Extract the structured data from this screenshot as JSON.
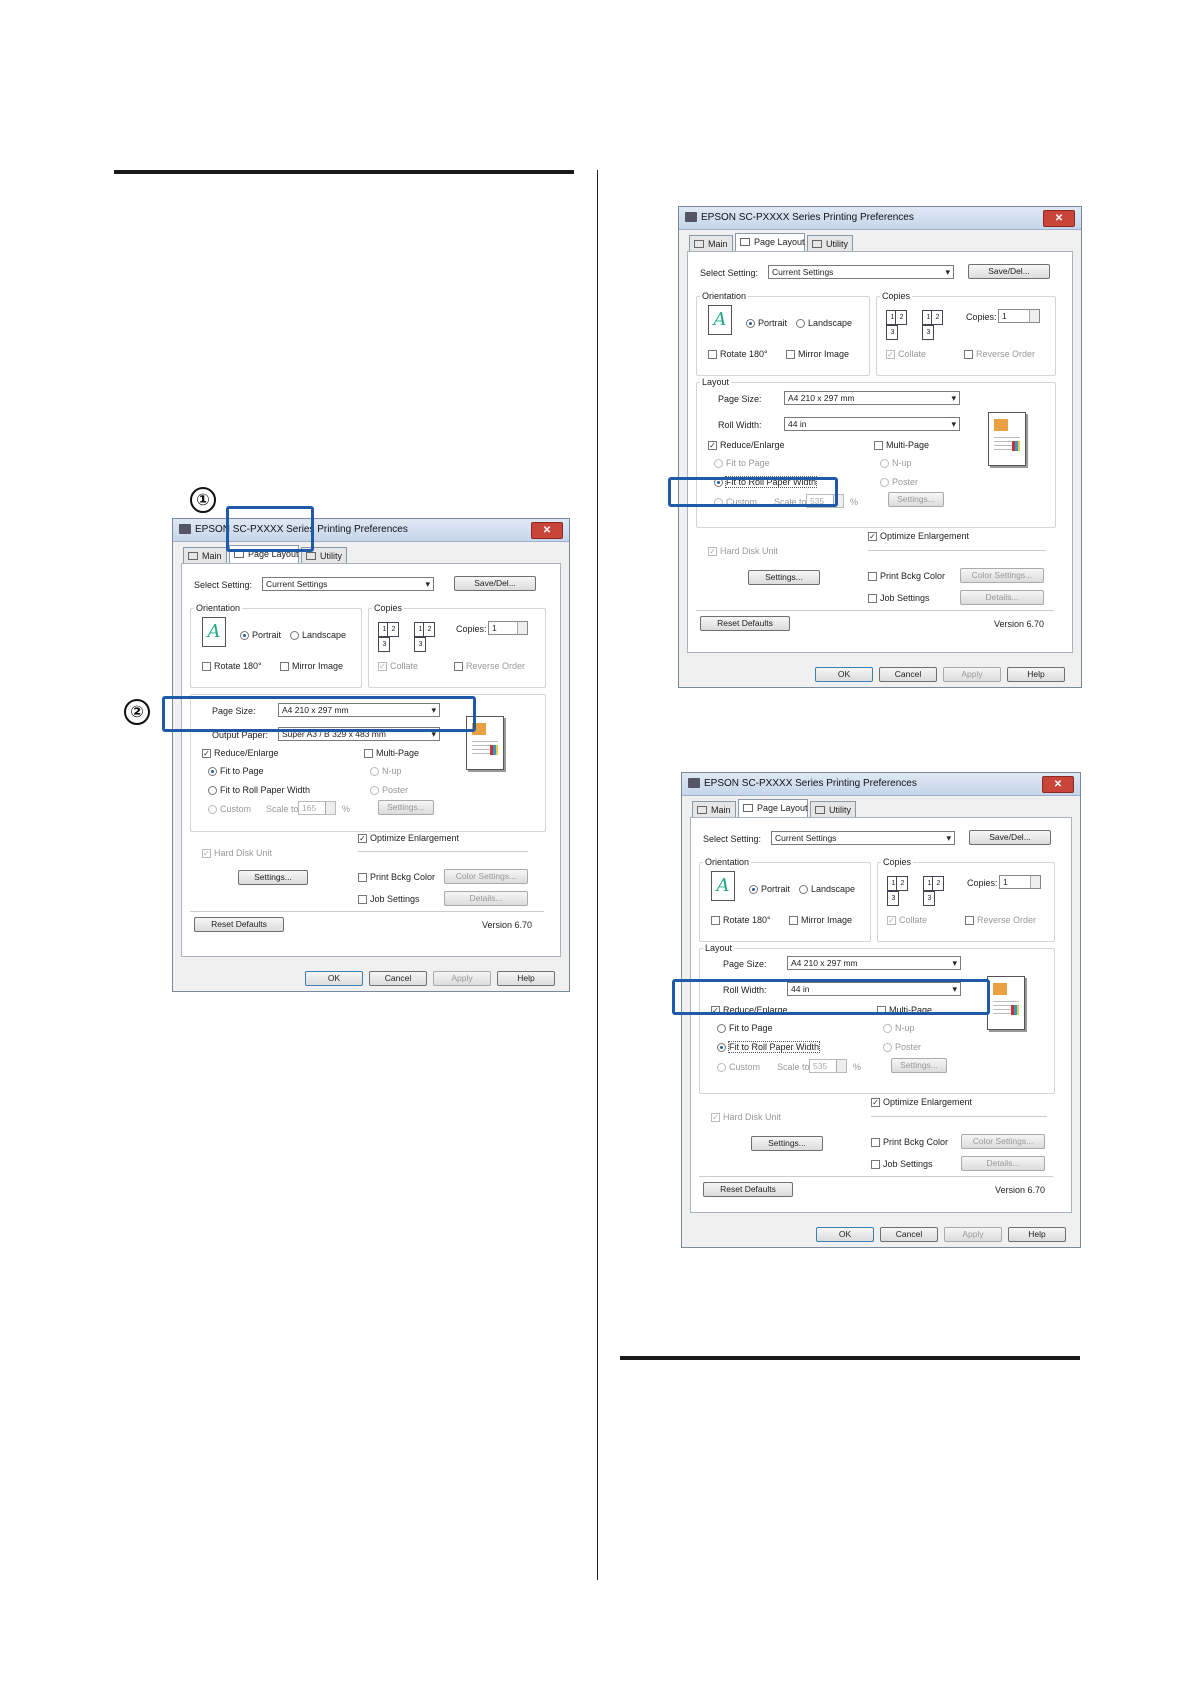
{
  "callouts": {
    "step1": "①",
    "step2": "②"
  },
  "colors": {
    "highlight": "#1e5aa8",
    "rule": "#1a1a1a"
  },
  "dialog1": {
    "title": "EPSON SC-PXXXX Series Printing Preferences",
    "close": "✕",
    "tabs": [
      "Main",
      "Page Layout",
      "Utility"
    ],
    "select_setting_label": "Select Setting:",
    "select_setting_value": "Current Settings",
    "save_del": "Save/Del...",
    "orientation_label": "Orientation",
    "portrait": "Portrait",
    "landscape": "Landscape",
    "rotate": "Rotate 180°",
    "mirror": "Mirror Image",
    "copies_group": "Copies",
    "copies_label": "Copies:",
    "copies_value": "1",
    "collate": "Collate",
    "reverse": "Reverse Order",
    "page_size_label": "Page Size:",
    "page_size_value": "A4 210 x 297 mm",
    "output_paper_label": "Output Paper:",
    "output_paper_value": "Super A3 / B 329 x 483 mm",
    "reduce": "Reduce/Enlarge",
    "fit_page": "Fit to Page",
    "fit_roll": "Fit to Roll Paper Width",
    "custom": "Custom",
    "scale_label": "Scale to",
    "scale_value": "165",
    "percent": "%",
    "multi_page": "Multi-Page",
    "nup": "N-up",
    "poster": "Poster",
    "settings_small": "Settings...",
    "optimize": "Optimize Enlargement",
    "hdd": "Hard Disk Unit",
    "settings": "Settings...",
    "print_bckg": "Print Bckg Color",
    "color_settings": "Color Settings...",
    "job_settings": "Job Settings",
    "details": "Details...",
    "reset": "Reset Defaults",
    "version": "Version 6.70",
    "ok": "OK",
    "cancel": "Cancel",
    "apply": "Apply",
    "help": "Help"
  },
  "dialog2": {
    "title": "EPSON SC-PXXXX Series Printing Preferences",
    "close": "✕",
    "tabs": [
      "Main",
      "Page Layout",
      "Utility"
    ],
    "select_setting_label": "Select Setting:",
    "select_setting_value": "Current Settings",
    "save_del": "Save/Del...",
    "orientation_label": "Orientation",
    "portrait": "Portrait",
    "landscape": "Landscape",
    "rotate": "Rotate 180°",
    "mirror": "Mirror Image",
    "copies_group": "Copies",
    "copies_label": "Copies:",
    "copies_value": "1",
    "collate": "Collate",
    "reverse": "Reverse Order",
    "layout_label": "Layout",
    "page_size_label": "Page Size:",
    "page_size_value": "A4 210 x 297 mm",
    "roll_width_label": "Roll Width:",
    "roll_width_value": "44 in",
    "reduce": "Reduce/Enlarge",
    "fit_page": "Fit to Page",
    "fit_roll": "Fit to Roll Paper Width",
    "custom": "Custom",
    "scale_label": "Scale to",
    "scale_value": "535",
    "percent": "%",
    "multi_page": "Multi-Page",
    "nup": "N-up",
    "poster": "Poster",
    "settings_small": "Settings...",
    "optimize": "Optimize Enlargement",
    "hdd": "Hard Disk Unit",
    "settings": "Settings...",
    "print_bckg": "Print Bckg Color",
    "color_settings": "Color Settings...",
    "job_settings": "Job Settings",
    "details": "Details...",
    "reset": "Reset Defaults",
    "version": "Version 6.70",
    "ok": "OK",
    "cancel": "Cancel",
    "apply": "Apply",
    "help": "Help"
  },
  "dialog3": {
    "title": "EPSON SC-PXXXX Series Printing Preferences",
    "close": "✕",
    "tabs": [
      "Main",
      "Page Layout",
      "Utility"
    ],
    "select_setting_label": "Select Setting:",
    "select_setting_value": "Current Settings",
    "save_del": "Save/Del...",
    "orientation_label": "Orientation",
    "portrait": "Portrait",
    "landscape": "Landscape",
    "rotate": "Rotate 180°",
    "mirror": "Mirror Image",
    "copies_group": "Copies",
    "copies_label": "Copies:",
    "copies_value": "1",
    "collate": "Collate",
    "reverse": "Reverse Order",
    "layout_label": "Layout",
    "page_size_label": "Page Size:",
    "page_size_value": "A4 210 x 297 mm",
    "roll_width_label": "Roll Width:",
    "roll_width_value": "44 in",
    "reduce": "Reduce/Enlarge",
    "fit_page": "Fit to Page",
    "fit_roll": "Fit to Roll Paper Width",
    "custom": "Custom",
    "scale_label": "Scale to",
    "scale_value": "535",
    "percent": "%",
    "multi_page": "Multi-Page",
    "nup": "N-up",
    "poster": "Poster",
    "settings_small": "Settings...",
    "optimize": "Optimize Enlargement",
    "hdd": "Hard Disk Unit",
    "settings": "Settings...",
    "print_bckg": "Print Bckg Color",
    "color_settings": "Color Settings...",
    "job_settings": "Job Settings",
    "details": "Details...",
    "reset": "Reset Defaults",
    "version": "Version 6.70",
    "ok": "OK",
    "cancel": "Cancel",
    "apply": "Apply",
    "help": "Help"
  }
}
